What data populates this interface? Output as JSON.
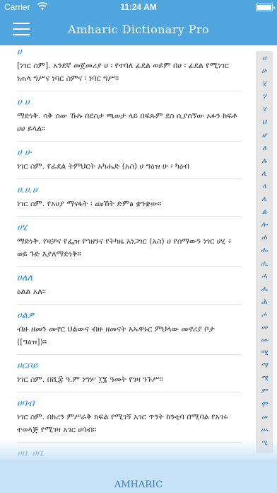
{
  "status_bar": {
    "carrier": "Carrier",
    "time": "11:24 AM"
  },
  "header": {
    "title": "Amharic Dictionary Pro"
  },
  "entries": [
    {
      "headword": "ሀ",
      "definition": "[ነገር ስም]. አንደኛ መጀመሪያ ሀ ፡ የተባለ ፊደል ወይም በሀ ፡ ፊደል የሚነገር ነጠላ ግሥና ነባር ስምና ፡ ነባር ግሥ።"
    },
    {
      "headword": "ሀ ሀ",
      "definition": "ማድነቅ. ሳቅ ሰው ኹሉ በደስታ ጫወታ ላይ በፍጹም ደስ ሲያሰኘው አፉን ከፍቶ ሀሀ ይላል።"
    },
    {
      "headword": "ሀ ሁ",
      "definition": "ነገር ስም. የፊደል ትምህርት አካሔድ (አስ) ሀ ግዕዝ ሁ ፡ ካዕብ"
    },
    {
      "headword": "ሀ.ሀ.ሀ",
      "definition": "ነገር ስም. የአሀያ ማናፋት ፡ ጩኸት ድምፅ ቋንቋው።"
    },
    {
      "headword": "ሀሂ",
      "definition": "ማድነቅ. የዛቻና የፌዝ የኀዘንና የትካዜ አነጋገር (አስ) ሀ የሰማውን ነገር ሀሂ ፥ ወይ ጉድ እያለማድነቅ።"
    },
    {
      "headword": "ሀለለ",
      "definition": "ዕልል አለ።"
    },
    {
      "headword": "ሀልዎ",
      "definition": "ብዙ ዘመን መኖር ህልውና ብዙ ዘመናት አኡዋኑር ምህላው መኖሪያ ቦታ ([ግዕዝ])።"
    },
    {
      "headword": "ሀርቦይ",
      "definition": "ነገር ስም. በሺ፰ ዓ.ም ነግሦ ፲፮ ዓመት የገዛ ንጉሥ።"
    },
    {
      "headword": "ሀባብ",
      "definition": "ነገር ስም. በከረን ምሥራቅ ክፍል የሚገኝ አገር ጥንት ከንቲባ በሚባል የአገሩ ተወላጅ የሚገዛ አገር ሀባብ።"
    },
    {
      "headword": "ሀቢ ሀቢ",
      "definition": ""
    }
  ],
  "index": [
    "ሀ",
    "ሁ",
    "ሂ",
    "ሃ",
    "ሄ",
    "ህ",
    "ሆ",
    "ለ",
    "ሉ",
    "ሊ",
    "ላ",
    "ሌ",
    "ል",
    "ሎ",
    "ሐ",
    "ሑ",
    "ሒ",
    "ሓ",
    "ሔ",
    "ሕ",
    "ሖ",
    "መ",
    "ሙ",
    "ሚ",
    "ማ",
    "ሜ",
    "ም",
    "ሞ",
    "ሠ",
    "ሡ",
    "ሢ"
  ],
  "footer": {
    "label": "AMHARIC"
  }
}
